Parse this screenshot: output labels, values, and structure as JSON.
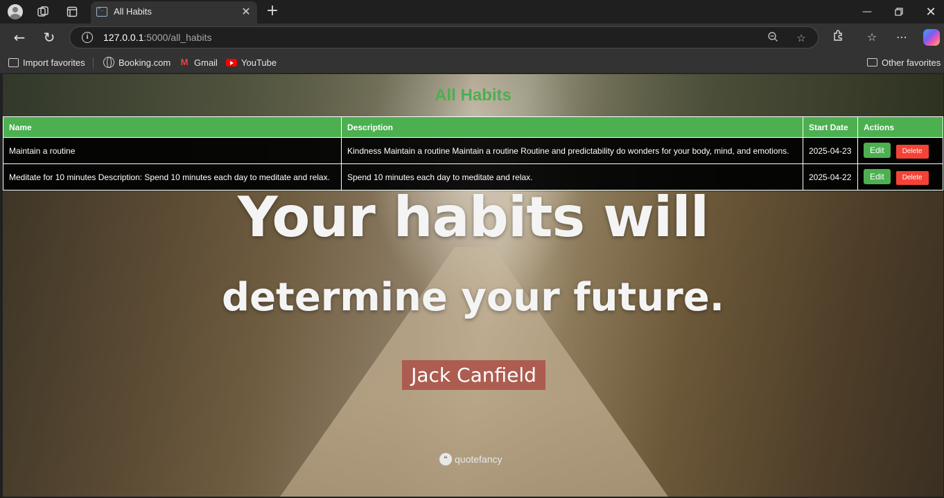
{
  "browser": {
    "tab_title": "All Habits",
    "url_host": "127.0.0.1",
    "url_path": ":5000/all_habits"
  },
  "favorites": {
    "import": "Import favorites",
    "booking": "Booking.com",
    "gmail": "Gmail",
    "youtube": "YouTube",
    "other": "Other favorites"
  },
  "page": {
    "title": "All Habits",
    "columns": [
      "Name",
      "Description",
      "Start Date",
      "Actions"
    ],
    "rows": [
      {
        "name": "Maintain a routine",
        "description": "Kindness Maintain a routine Maintain a routine Routine and predictability do wonders for your body, mind, and emotions.",
        "start_date": "2025-04-23",
        "edit": "Edit",
        "delete": "Delete"
      },
      {
        "name": "Meditate for 10 minutes Description: Spend 10 minutes each day to meditate and relax.",
        "description": "Spend 10 minutes each day to meditate and relax.",
        "start_date": "2025-04-22",
        "edit": "Edit",
        "delete": "Delete"
      }
    ]
  },
  "background_quote": {
    "line1": "Your habits will",
    "line2": "determine your future.",
    "author": "Jack Canfield",
    "brand": "quotefancy"
  },
  "colors": {
    "accent_green": "#4caf50",
    "delete_red": "#f44336"
  }
}
